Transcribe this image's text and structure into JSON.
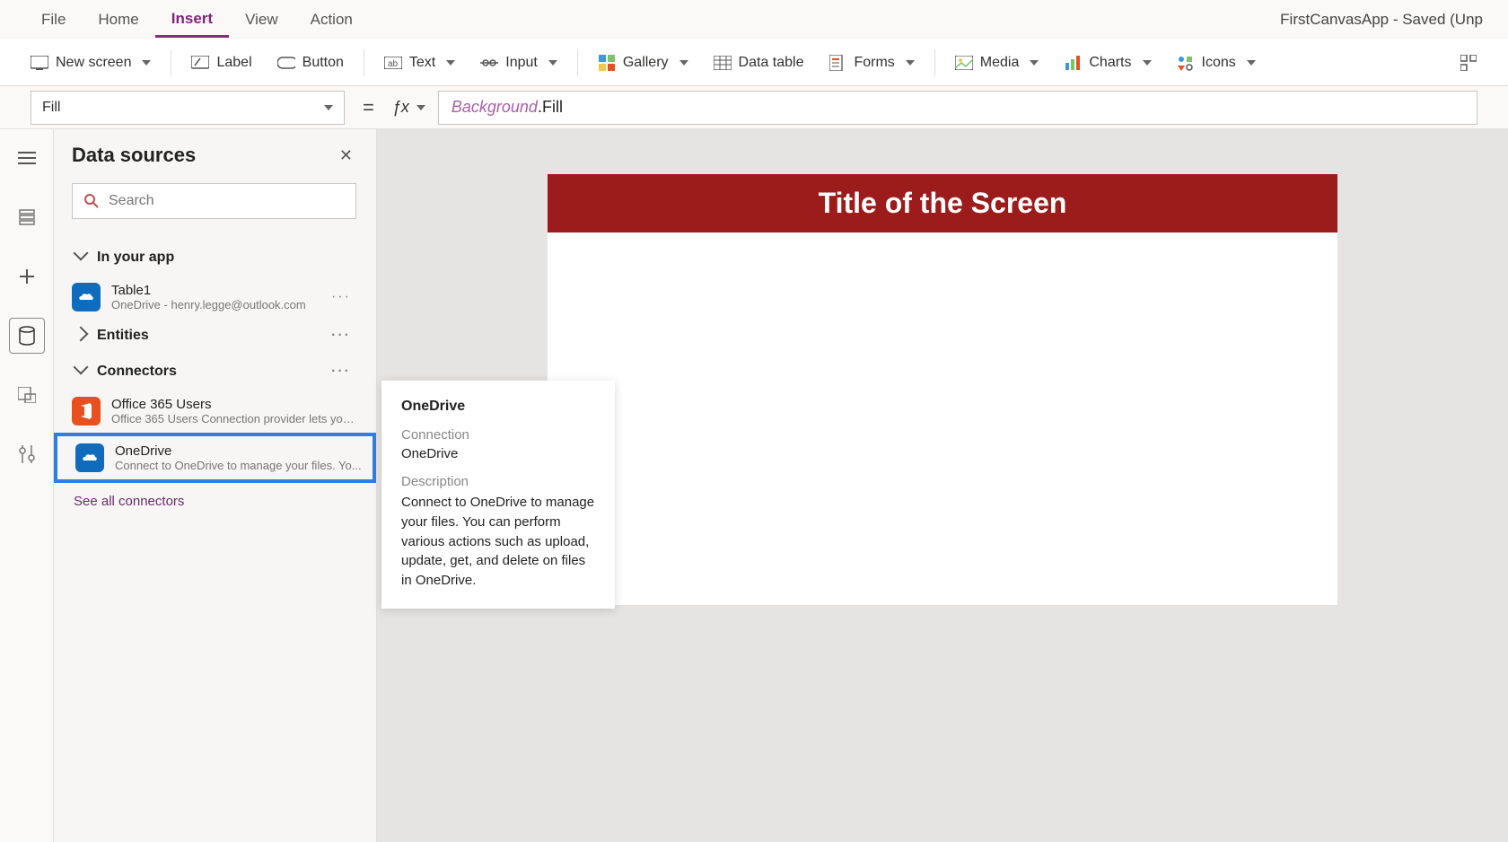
{
  "menubar": {
    "items": [
      "File",
      "Home",
      "Insert",
      "View",
      "Action"
    ],
    "active_index": 2,
    "app_title": "FirstCanvasApp - Saved (Unp"
  },
  "ribbon": {
    "new_screen": "New screen",
    "label": "Label",
    "button": "Button",
    "text": "Text",
    "input": "Input",
    "gallery": "Gallery",
    "data_table": "Data table",
    "forms": "Forms",
    "media": "Media",
    "charts": "Charts",
    "icons": "Icons"
  },
  "formula": {
    "property": "Fill",
    "token1": "Background",
    "token2": ".Fill"
  },
  "panel": {
    "title": "Data sources",
    "search_placeholder": "Search",
    "section_in_app": "In your app",
    "section_entities": "Entities",
    "section_connectors": "Connectors",
    "see_all": "See all connectors",
    "in_app": {
      "name": "Table1",
      "sub": "OneDrive - henry.legge@outlook.com"
    },
    "connectors": [
      {
        "name": "Office 365 Users",
        "sub": "Office 365 Users Connection provider lets you ..."
      },
      {
        "name": "OneDrive",
        "sub": "Connect to OneDrive to manage your files. Yo..."
      }
    ]
  },
  "flyout": {
    "title": "OneDrive",
    "connection_label": "Connection",
    "connection_value": "OneDrive",
    "description_label": "Description",
    "description_value": "Connect to OneDrive to manage your files. You can perform various actions such as upload, update, get, and delete on files in OneDrive."
  },
  "canvas": {
    "screen_title": "Title of the Screen"
  }
}
